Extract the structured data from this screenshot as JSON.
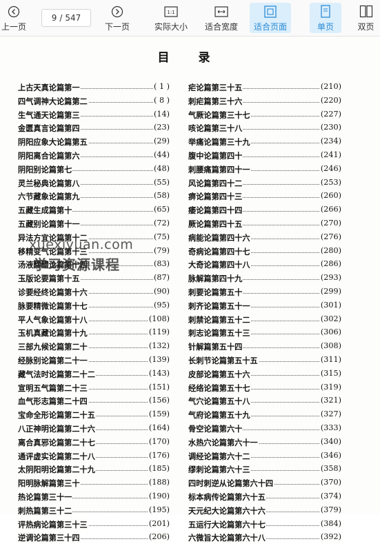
{
  "toolbar": {
    "prev_label": "上一页",
    "page_current": "9",
    "page_separator": "/",
    "page_total": "547",
    "next_label": "下一页",
    "actual_size_label": "实际大小",
    "actual_size_icon_text": "1:1",
    "fit_width_label": "适合宽度",
    "fit_page_label": "适合页面",
    "single_page_label": "单页",
    "double_page_label": "双页",
    "accent_color": "#2a8bd6"
  },
  "document": {
    "title": "目 录",
    "left_entries": [
      {
        "title": "上古天真论篇第一",
        "page": "( 1 )"
      },
      {
        "title": "四气调神大论篇第二",
        "page": "( 8 )"
      },
      {
        "title": "生气通天论篇第三",
        "page": "(14)"
      },
      {
        "title": "金匮真言论篇第四",
        "page": "(23)"
      },
      {
        "title": "阴阳应象大论篇第五",
        "page": "(29)"
      },
      {
        "title": "阴阳离合论篇第六",
        "page": "(44)"
      },
      {
        "title": "阴阳别论篇第七",
        "page": "(48)"
      },
      {
        "title": "灵兰秘典论篇第八",
        "page": "(55)"
      },
      {
        "title": "六节藏象论篇第九",
        "page": "(58)"
      },
      {
        "title": "五藏生成篇第十",
        "page": "(65)"
      },
      {
        "title": "五藏别论篇第十一",
        "page": "(72)"
      },
      {
        "title": "异法方宜论篇第十二",
        "page": "(75)"
      },
      {
        "title": "移精变气论篇第十三",
        "page": "(79)"
      },
      {
        "title": "汤液醪醴论篇第十四",
        "page": "(83)"
      },
      {
        "title": "玉版论要篇第十五",
        "page": "(87)"
      },
      {
        "title": "诊要经终论篇第十六",
        "page": "(90)"
      },
      {
        "title": "脉要精微论篇第十七",
        "page": "(95)"
      },
      {
        "title": "平人气象论篇第十八",
        "page": "(108)"
      },
      {
        "title": "玉机真藏论篇第十九",
        "page": "(119)"
      },
      {
        "title": "三部九候论篇第二十",
        "page": "(132)"
      },
      {
        "title": "经脉别论篇第二十一",
        "page": "(139)"
      },
      {
        "title": "藏气法时论篇第二十二",
        "page": "(143)"
      },
      {
        "title": "宣明五气篇第二十三",
        "page": "(151)"
      },
      {
        "title": "血气形志篇第二十四",
        "page": "(156)"
      },
      {
        "title": "宝命全形论篇第二十五",
        "page": "(159)"
      },
      {
        "title": "八正神明论篇第二十六",
        "page": "(164)"
      },
      {
        "title": "离合真邪论篇第二十七",
        "page": "(170)"
      },
      {
        "title": "通评虚实论篇第二十八",
        "page": "(176)"
      },
      {
        "title": "太阴阳明论篇第二十九",
        "page": "(185)"
      },
      {
        "title": "阳明脉解篇第三十",
        "page": "(188)"
      },
      {
        "title": "热论篇第三十一",
        "page": "(190)"
      },
      {
        "title": "刺热篇第三十二",
        "page": "(195)"
      },
      {
        "title": "评热病论篇第三十三",
        "page": "(201)"
      },
      {
        "title": "逆调论篇第三十四",
        "page": "(206)"
      }
    ],
    "right_entries": [
      {
        "title": "疟论篇第三十五",
        "page": "(210)"
      },
      {
        "title": "刺疟篇第三十六",
        "page": "(220)"
      },
      {
        "title": "气厥论篇第三十七",
        "page": "(227)"
      },
      {
        "title": "咳论篇第三十八",
        "page": "(230)"
      },
      {
        "title": "举痛论篇第三十九",
        "page": "(234)"
      },
      {
        "title": "腹中论篇第四十",
        "page": "(241)"
      },
      {
        "title": "刺腰痛篇第四十一",
        "page": "(246)"
      },
      {
        "title": "风论篇第四十二",
        "page": "(253)"
      },
      {
        "title": "痹论篇第四十三",
        "page": "(260)"
      },
      {
        "title": "痿论篇第四十四",
        "page": "(266)"
      },
      {
        "title": "厥论篇第四十五",
        "page": "(270)"
      },
      {
        "title": "病能论篇第四十六",
        "page": "(276)"
      },
      {
        "title": "奇病论篇第四十七",
        "page": "(280)"
      },
      {
        "title": "大奇论篇第四十八",
        "page": "(286)"
      },
      {
        "title": "脉解篇第四十九",
        "page": "(293)"
      },
      {
        "title": "刺要论篇第五十",
        "page": "(299)"
      },
      {
        "title": "刺齐论篇第五十一",
        "page": "(301)"
      },
      {
        "title": "刺禁论篇第五十二",
        "page": "(302)"
      },
      {
        "title": "刺志论篇第五十三",
        "page": "(306)"
      },
      {
        "title": "针解篇第五十四",
        "page": "(308)"
      },
      {
        "title": "长刺节论篇第五十五",
        "page": "(311)"
      },
      {
        "title": "皮部论篇第五十六",
        "page": "(315)"
      },
      {
        "title": "经络论篇第五十七",
        "page": "(319)"
      },
      {
        "title": "气穴论篇第五十八",
        "page": "(321)"
      },
      {
        "title": "气府论篇第五十九",
        "page": "(327)"
      },
      {
        "title": "骨空论篇第六十",
        "page": "(333)"
      },
      {
        "title": "水热穴论篇第六十一",
        "page": "(340)"
      },
      {
        "title": "调经论篇第六十二",
        "page": "(346)"
      },
      {
        "title": "缪刺论篇第六十三",
        "page": "(358)"
      },
      {
        "title": "四时刺逆从论篇第六十四",
        "page": "(370)"
      },
      {
        "title": "标本病传论篇第六十五",
        "page": "(374)"
      },
      {
        "title": "天元纪大论篇第六十六",
        "page": "(379)"
      },
      {
        "title": "五运行大论篇第六十七",
        "page": "(384)"
      },
      {
        "title": "六微旨大论篇第六十八",
        "page": "(392)"
      }
    ]
  },
  "watermark": {
    "line1": "xuexiyuan.com",
    "line2": "学习资源课程"
  }
}
